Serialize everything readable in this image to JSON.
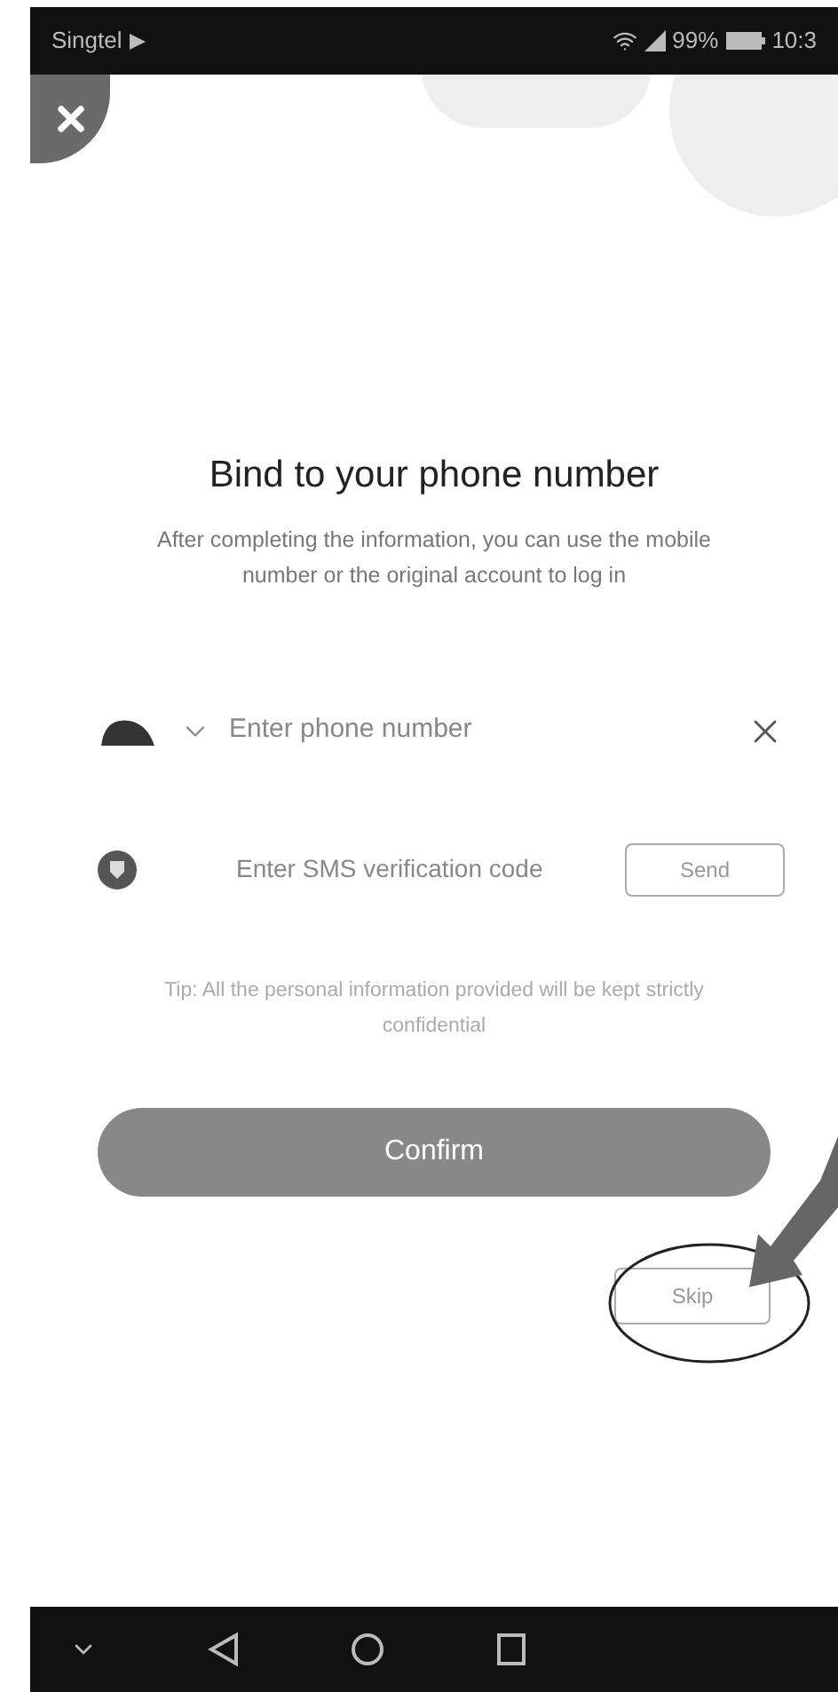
{
  "status_bar": {
    "carrier": "Singtel",
    "battery": "99%",
    "time": "10:3"
  },
  "title": "Bind to your phone number",
  "subtitle": "After completing the information, you can use the mobile number or the original account to log in",
  "phone_field": {
    "placeholder": "Enter phone number"
  },
  "sms_field": {
    "placeholder": "Enter SMS verification code"
  },
  "send_button": "Send",
  "tip": "Tip: All the personal information provided will be kept strictly confidential",
  "confirm_button": {
    "label": "Confirm",
    "disabled": true
  },
  "skip_button": "Skip"
}
